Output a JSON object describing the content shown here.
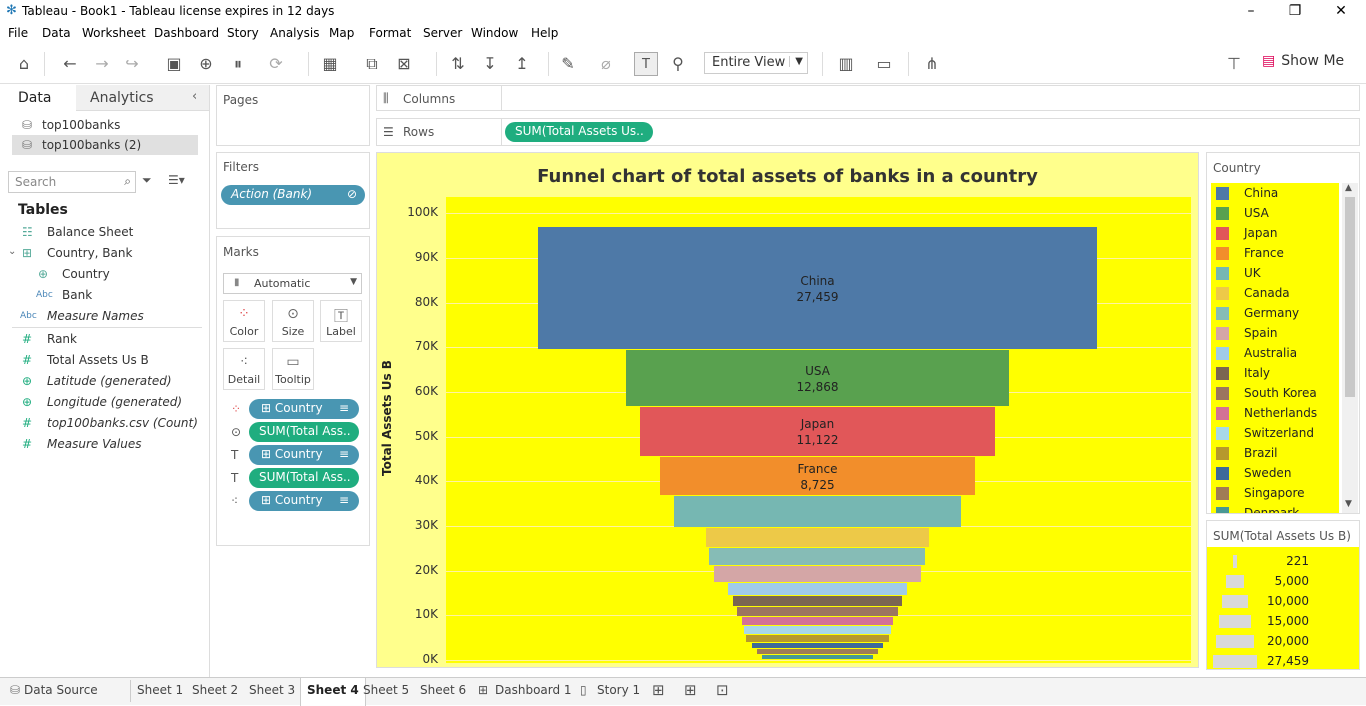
{
  "window": {
    "title": "Tableau - Book1 - Tableau license expires in 12 days"
  },
  "menu": [
    "File",
    "Data",
    "Worksheet",
    "Dashboard",
    "Story",
    "Analysis",
    "Map",
    "Format",
    "Server",
    "Window",
    "Help"
  ],
  "toolbar": {
    "fit": "Entire View",
    "show_me": "Show Me"
  },
  "left": {
    "tab_data": "Data",
    "tab_analytics": "Analytics",
    "sources": [
      "top100banks",
      "top100banks (2)"
    ],
    "search_placeholder": "Search",
    "tables_header": "Tables",
    "fields": [
      "Balance Sheet",
      "Country, Bank",
      "Country",
      "Bank",
      "Measure Names",
      "Rank",
      "Total Assets Us B",
      "Latitude (generated)",
      "Longitude (generated)",
      "top100banks.csv (Count)",
      "Measure Values"
    ]
  },
  "shelves": {
    "pages": "Pages",
    "filters": "Filters",
    "filter_pill": "Action (Bank)",
    "marks": "Marks",
    "mark_type": "Automatic",
    "mark_buttons": [
      "Color",
      "Size",
      "Label",
      "Detail",
      "Tooltip"
    ],
    "mark_pills": [
      "Country",
      "SUM(Total Ass..",
      "Country",
      "SUM(Total Ass..",
      "Country"
    ],
    "columns": "Columns",
    "rows": "Rows",
    "rows_pill": "SUM(Total Assets Us.."
  },
  "chart_data": {
    "type": "bar",
    "title": "Funnel chart of total assets of banks in a country",
    "ylabel": "Total Assets Us B",
    "yticks": [
      "100K",
      "90K",
      "80K",
      "70K",
      "60K",
      "50K",
      "40K",
      "30K",
      "20K",
      "10K",
      "0K"
    ],
    "ylim": [
      0,
      103000
    ],
    "categories": [
      "China",
      "USA",
      "Japan",
      "France",
      "UK",
      "Canada",
      "Germany",
      "Spain",
      "Australia",
      "Italy",
      "South Korea",
      "Netherlands",
      "Switzerland",
      "Brazil",
      "Sweden",
      "Singapore",
      "Denmark"
    ],
    "values": [
      27459,
      12868,
      11122,
      8725,
      7200,
      4400,
      4100,
      3800,
      2800,
      2500,
      2300,
      2000,
      1900,
      1800,
      1500,
      1300,
      1100
    ],
    "labels_shown": [
      "China",
      "USA",
      "Japan",
      "France"
    ],
    "colors": [
      "#4e79a7",
      "#59a14f",
      "#e15759",
      "#f28e2b",
      "#76b7b2",
      "#edc948",
      "#86bcb6",
      "#d4a6a6",
      "#a0cbe8",
      "#7b6651",
      "#9c755f",
      "#d37295",
      "#a8d8e8",
      "#b6992d",
      "#3e6a9a",
      "#a07c56",
      "#499894"
    ]
  },
  "legend": {
    "title": "Country",
    "items": [
      "China",
      "USA",
      "Japan",
      "France",
      "UK",
      "Canada",
      "Germany",
      "Spain",
      "Australia",
      "Italy",
      "South Korea",
      "Netherlands",
      "Switzerland",
      "Brazil",
      "Sweden",
      "Singapore",
      "Denmark"
    ]
  },
  "size_legend": {
    "title": "SUM(Total Assets Us B)",
    "values": [
      "221",
      "5,000",
      "10,000",
      "15,000",
      "20,000",
      "27,459"
    ]
  },
  "tabs": [
    "Data Source",
    "Sheet 1",
    "Sheet 2",
    "Sheet 3",
    "Sheet 4",
    "Sheet 5",
    "Sheet 6",
    "Dashboard 1",
    "Story 1"
  ]
}
